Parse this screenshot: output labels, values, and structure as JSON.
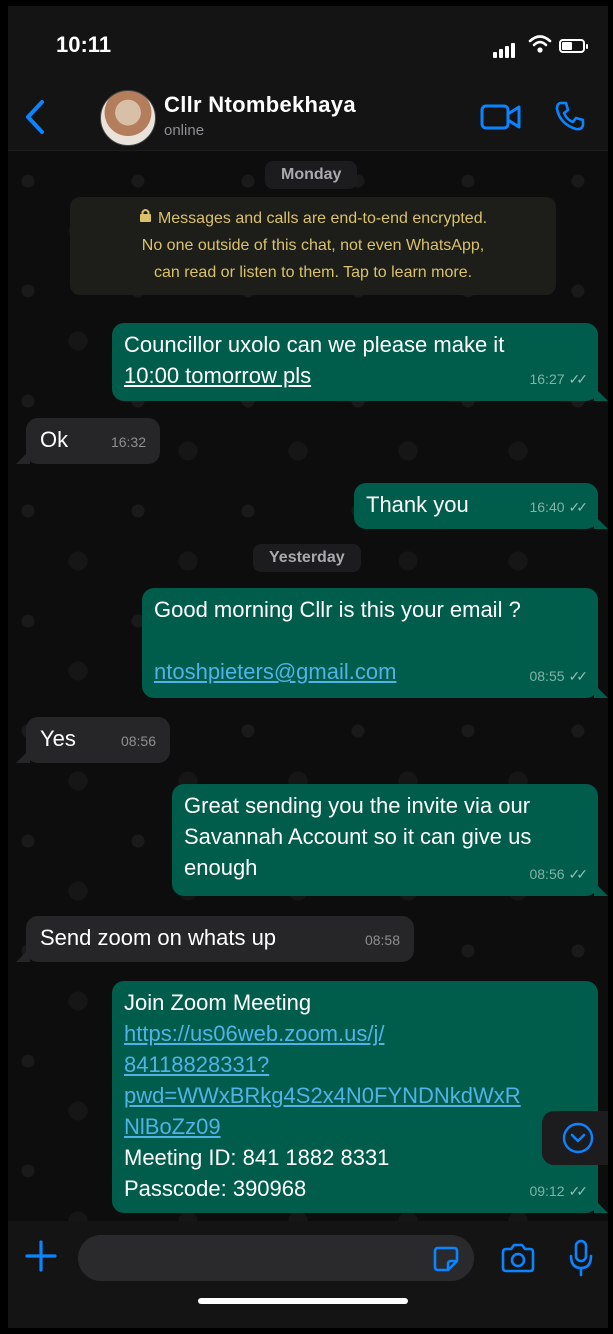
{
  "status_bar": {
    "time": "10:11"
  },
  "header": {
    "contact_name": "Cllr  Ntombekhaya",
    "contact_status": "online"
  },
  "date_separators": [
    "Monday",
    "Yesterday"
  ],
  "encryption_notice": {
    "lines": [
      "Messages and calls are end-to-end encrypted.",
      "No one outside of this chat, not even WhatsApp,",
      "can read or listen to them. Tap to learn more."
    ]
  },
  "messages": [
    {
      "dir": "out",
      "lines": [
        "Councillor uxolo can we please make it",
        "10:00 tomorrow pls"
      ],
      "time": "16:27"
    },
    {
      "dir": "in",
      "text": "Ok",
      "time": "16:32"
    },
    {
      "dir": "out",
      "text": "Thank you",
      "time": "16:40"
    },
    {
      "dir": "out",
      "text": "Good morning Cllr is this your email ?",
      "link": "ntoshpieters@gmail.com",
      "time": "08:55"
    },
    {
      "dir": "in",
      "text": "Yes",
      "time": "08:56"
    },
    {
      "dir": "out",
      "lines": [
        "Great sending you the invite via our",
        "Savannah Account so it can give us",
        "enough"
      ],
      "time": "08:56"
    },
    {
      "dir": "in",
      "text": "Send zoom on whats  up",
      "time": "08:58"
    },
    {
      "dir": "out",
      "title": "Join Zoom Meeting",
      "link_lines": [
        "https://us06web.zoom.us/j/",
        "84118828331?",
        "pwd=WWxBRkg4S2x4N0FYNDNkdWxR",
        "NlBoZz09"
      ],
      "id_line": "Meeting ID: 841 1882 8331",
      "pass_line": "Passcode: 390968",
      "time": "09:12"
    }
  ],
  "colors": {
    "outgoing": "#005c4b",
    "incoming": "#262628",
    "accent": "#0a84ff",
    "link": "#4fb3e8"
  }
}
